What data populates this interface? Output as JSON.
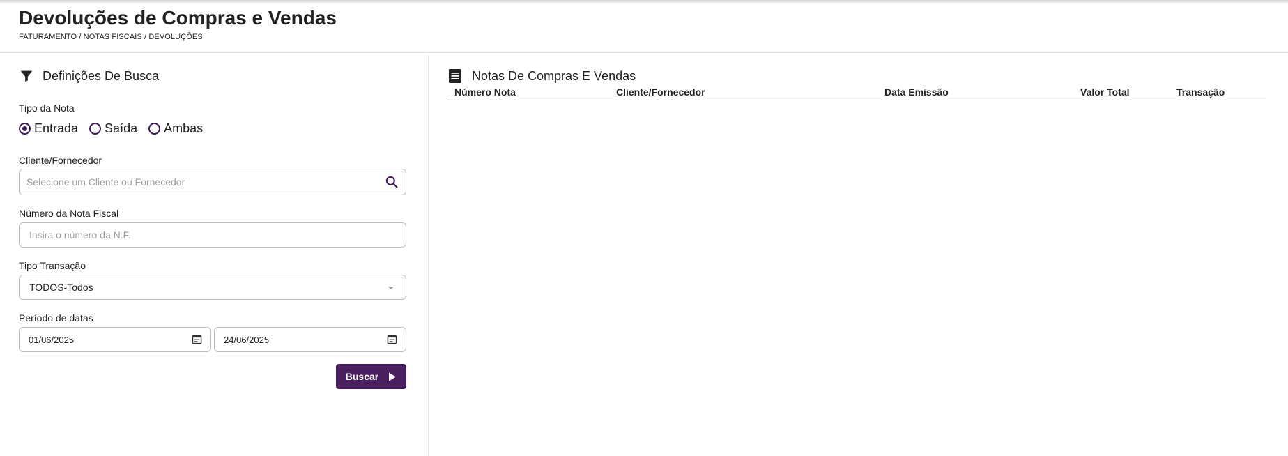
{
  "header": {
    "title": "Devoluções de Compras e Vendas",
    "breadcrumb": "FATURAMENTO / NOTAS FISCAIS / DEVOLUÇÕES"
  },
  "filters": {
    "section_title": "Definições De Busca",
    "tipo_nota": {
      "label": "Tipo da Nota",
      "options": [
        "Entrada",
        "Saída",
        "Ambas"
      ],
      "selected": "Entrada"
    },
    "cliente": {
      "label": "Cliente/Fornecedor",
      "placeholder": "Selecione um Cliente ou Fornecedor"
    },
    "numero_nf": {
      "label": "Número da Nota Fiscal",
      "placeholder": "Insira o número da N.F."
    },
    "tipo_transacao": {
      "label": "Tipo Transação",
      "value": "TODOS-Todos"
    },
    "periodo": {
      "label": "Período de datas",
      "start": "01/06/2025",
      "end": "24/06/2025"
    },
    "search_button": "Buscar"
  },
  "results": {
    "section_title": "Notas De Compras E Vendas",
    "columns": [
      "Número Nota",
      "Cliente/Fornecedor",
      "Data Emissão",
      "Valor Total",
      "Transação"
    ],
    "rows": []
  },
  "colors": {
    "accent": "#4a1f5f",
    "radio": "#3d1a57",
    "border": "#bdbdbd"
  },
  "icons": {
    "filter": "filter-icon",
    "list": "list-icon",
    "search": "search-icon",
    "calendar": "calendar-icon",
    "dropdown": "caret-down-icon",
    "play": "play-icon"
  }
}
